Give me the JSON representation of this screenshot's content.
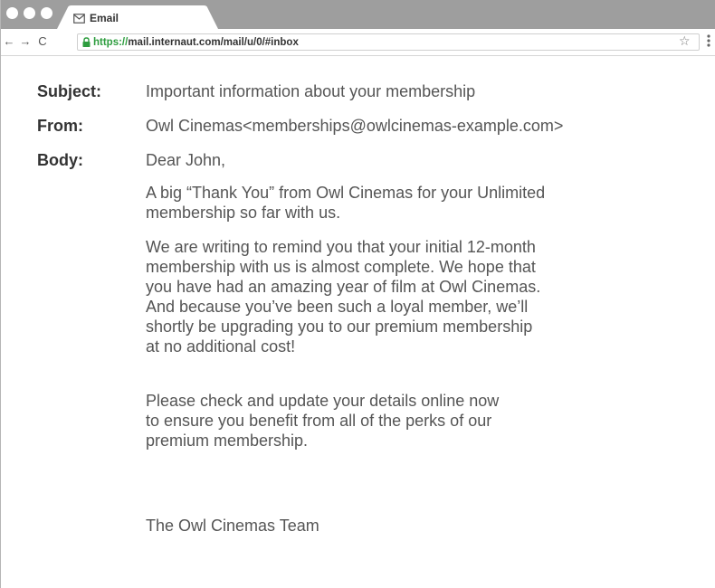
{
  "browser": {
    "tab_title": "Email",
    "url_scheme": "https://",
    "url_rest": "mail.internaut.com/mail/u/0/#inbox",
    "nav": {
      "back": "←",
      "forward": "→",
      "reload": "C"
    },
    "star": "☆"
  },
  "email": {
    "subject_label": "Subject:",
    "subject": "Important information about your membership",
    "from_label": "From:",
    "from": "Owl Cinemas<memberships@owlcinemas-example.com>",
    "body_label": "Body:",
    "greeting": "Dear John,",
    "paragraph_1": [
      "A big “Thank You” from Owl Cinemas for your Unlimited",
      "membership so far with us."
    ],
    "paragraph_2": [
      "We are writing to remind you that your initial 12-month",
      "membership with us is almost complete. We hope that",
      "you have had an amazing year of film at Owl Cinemas.",
      "And because you’ve been such a loyal member, we’ll",
      "shortly be upgrading you to our premium membership",
      "at no additional cost!"
    ],
    "paragraph_3": [
      "Please check and update your details online now",
      "to ensure you benefit from all of the perks of our",
      "premium membership."
    ],
    "signature": "The Owl Cinemas Team"
  }
}
